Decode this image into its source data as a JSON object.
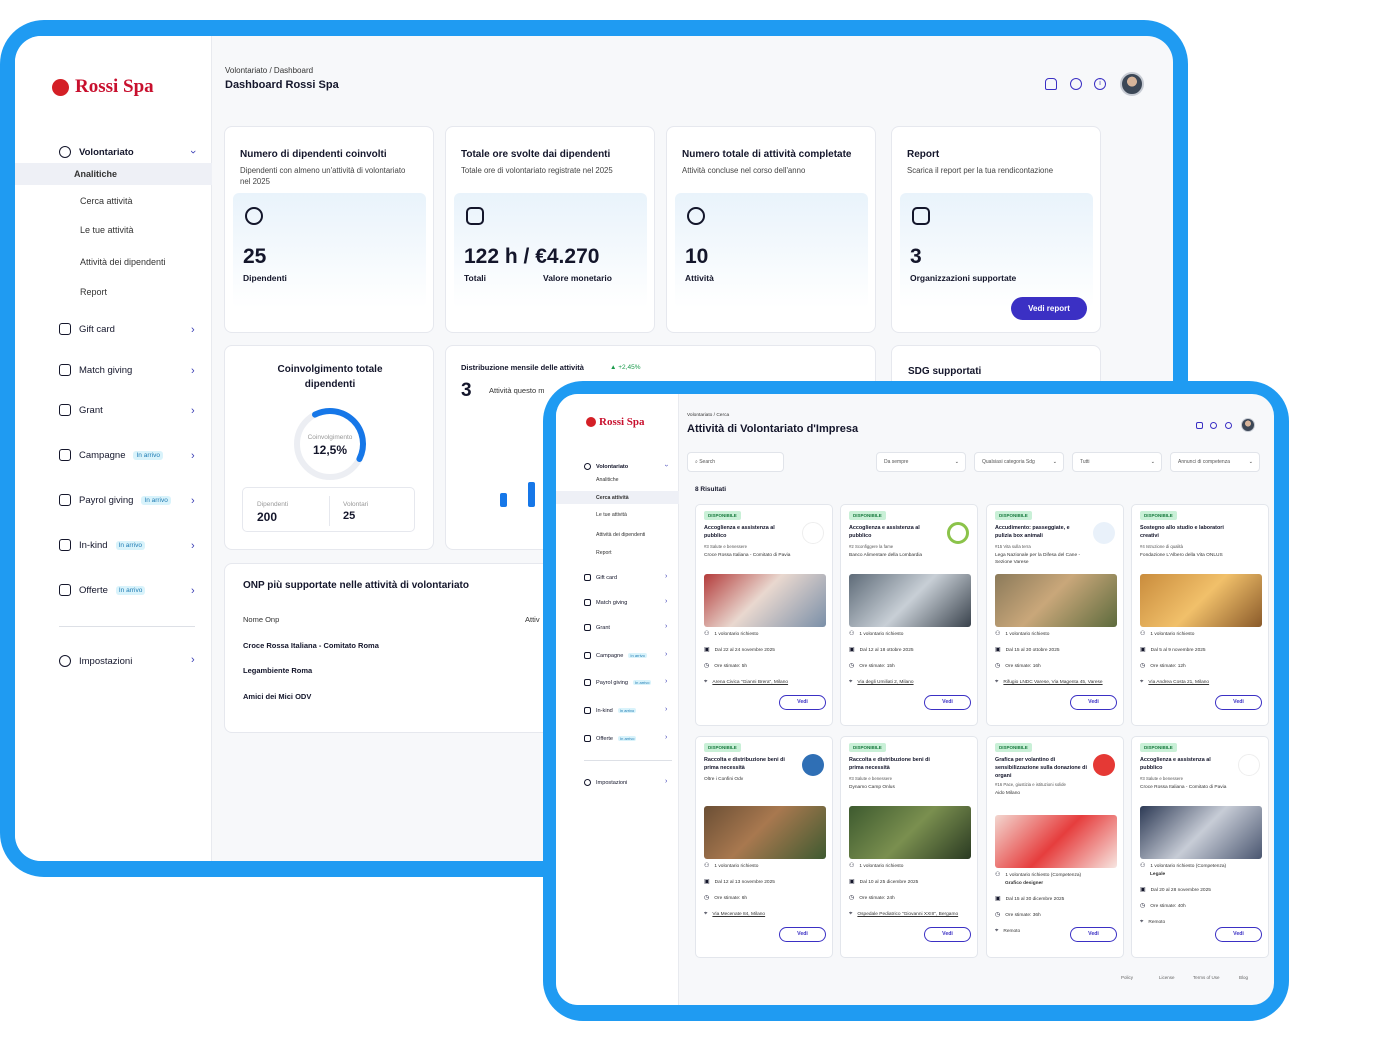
{
  "dashboard": {
    "brand": "Rossi Spa",
    "breadcrumb": "Volontariato / Dashboard",
    "title": "Dashboard Rossi Spa",
    "sidebar": {
      "volontariato": "Volontariato",
      "sub": [
        "Analitiche",
        "Cerca attività",
        "Le tue attività",
        "Attività dei dipendenti",
        "Report"
      ],
      "items": [
        {
          "label": "Gift card",
          "badge": ""
        },
        {
          "label": "Match giving",
          "badge": ""
        },
        {
          "label": "Grant",
          "badge": ""
        },
        {
          "label": "Campagne",
          "badge": "In arrivo"
        },
        {
          "label": "Payrol giving",
          "badge": "In arrivo"
        },
        {
          "label": "In-kind",
          "badge": "In arrivo"
        },
        {
          "label": "Offerte",
          "badge": "In arrivo"
        }
      ],
      "settings": "Impostazioni"
    },
    "cards": [
      {
        "title": "Numero di dipendenti coinvolti",
        "subtitle": "Dipendenti con almeno un'attività di volontariato nel 2025",
        "value": "25",
        "label": "Dipendenti"
      },
      {
        "title": "Totale ore svolte dai dipendenti",
        "subtitle": "Totale ore di volontariato registrate nel 2025",
        "value": "122 h / €4.270",
        "label": "Totali",
        "label2": "Valore monetario"
      },
      {
        "title": "Numero totale di attività completate",
        "subtitle": "Attività concluse nel corso dell'anno",
        "value": "10",
        "label": "Attività"
      },
      {
        "title": "Report",
        "subtitle": "Scarica il report per la tua rendicontazione",
        "value": "3",
        "label": "Organizzazioni supportate",
        "button": "Vedi report"
      }
    ],
    "engagement": {
      "title": "Coinvolgimento totale dipendenti",
      "gauge_label": "Coinvolgimento",
      "gauge_value": "12,5%",
      "gauge_fraction": 0.125,
      "dip_label": "Dipendenti",
      "dip_value": "200",
      "vol_label": "Volontari",
      "vol_value": "25"
    },
    "distribution": {
      "title": "Distribuzione mensile delle attività",
      "trend": "+2,45%",
      "value": "3",
      "caption": "Attività questo m"
    },
    "sdg": {
      "title": "SDG supportati"
    },
    "onp": {
      "title": "ONP più supportate nelle attività di volontariato",
      "col1": "Nome Onp",
      "col2": "Attiv",
      "rows": [
        "Croce Rossa Italiana - Comitato Roma",
        "Legambiente Roma",
        "Amici dei Mici ODV"
      ]
    }
  },
  "search_page": {
    "brand": "Rossi Spa",
    "breadcrumb": "Volontariato / Cerca",
    "title": "Attività di Volontariato d'Impresa",
    "sidebar": {
      "volontariato": "Volontariato",
      "sub": [
        "Analitiche",
        "Cerca attività",
        "Le tue attività",
        "Attività dei dipendenti",
        "Report"
      ],
      "items": [
        {
          "label": "Gift card",
          "badge": ""
        },
        {
          "label": "Match giving",
          "badge": ""
        },
        {
          "label": "Grant",
          "badge": ""
        },
        {
          "label": "Campagne",
          "badge": "In arrivo"
        },
        {
          "label": "Payrol giving",
          "badge": "In arrivo"
        },
        {
          "label": "In-kind",
          "badge": "In arrivo"
        },
        {
          "label": "Offerte",
          "badge": "In arrivo"
        }
      ],
      "settings": "Impostazioni"
    },
    "search_placeholder": "Search",
    "filters": [
      "Da sempre",
      "Qualsiasi categoria Sdg",
      "Tutti",
      "Annunci di competenza"
    ],
    "results": "8 Risultati",
    "status_label": "DISPONIBILE",
    "button": "Vedi",
    "activities": [
      {
        "title": "Accoglienza e assistenza al pubblico",
        "cat": "#3 Salute e benessere",
        "org": "Croce Rossa Italiana - Comitato di Pavia",
        "vol": "1 volontario richiesto",
        "date": "Dal 22 al 24 novembre 2025",
        "hours": "Ore stimate: 5h",
        "place": "Arena Civica \"Gianni Brera\", Milano",
        "extra": ""
      },
      {
        "title": "Accoglienza e assistenza al pubblico",
        "cat": "#2 Sconfiggere la fame",
        "org": "Banco Alimentare della Lombardia",
        "vol": "1 volontario richiesto",
        "date": "Dal 12 al 18 ottobre 2025",
        "hours": "Ore stimate: 15h",
        "place": "Via degli Umiliati 2, Milano",
        "extra": ""
      },
      {
        "title": "Accudimento: passeggiate, e pulizia box animali",
        "cat": "#15 Vita sulla terra",
        "org": "Lega Nazionale per la Difesa del Cane - Sezione Varese",
        "vol": "1 volontario richiesto",
        "date": "Dal 15 al 30 ottobre 2025",
        "hours": "Ore stimate: 16h",
        "place": "Rifugio LNDC Varese, Via Magenta 45, Varese",
        "extra": ""
      },
      {
        "title": "Sostegno allo studio e laboratori creativi",
        "cat": "#4 Istruzione di qualità",
        "org": "Fondazione L'Albero della Vita ONLUS",
        "vol": "1 volontario richiesto",
        "date": "Dal 5 al 9 novembre 2025",
        "hours": "Ore stimate: 12h",
        "place": "Via Andrea Costa 21, Milano",
        "extra": ""
      },
      {
        "title": "Raccolta e distribuzione beni di prima necessità",
        "cat": "",
        "org": "Oltre i Confini Odv",
        "vol": "1 volontario richiesto",
        "date": "Dal 12 al 13 novembre 2025",
        "hours": "Ore stimate: 6h",
        "place": "Via Mecenate 84, Milano",
        "extra": ""
      },
      {
        "title": "Raccolta e distribuzione beni di prima necessità",
        "cat": "#3 Salute e benessere",
        "org": "Dynamo Camp Onlus",
        "vol": "1 volontario richiesto",
        "date": "Dal 10 al 25 dicembre 2025",
        "hours": "Ore stimate: 24h",
        "place": "Ospedale Pediatrico \"Giovanni XXIII\", Bergamo",
        "extra": ""
      },
      {
        "title": "Grafica per volantino di sensibilizzazione sulla donazione di organi",
        "cat": "#16 Pace, giustizia e istituzioni solide",
        "org": "Aido Milano",
        "vol": "1 volontario richiesto (Competenza)",
        "date": "Dal 15 al 30 dicembre 2025",
        "hours": "Ore stimate: 36h",
        "place": "Remoto",
        "extra": "Grafico designer"
      },
      {
        "title": "Accoglienza e assistenza al pubblico",
        "cat": "#3 Salute e benessere",
        "org": "Croce Rossa Italiana - Comitato di Pavia",
        "vol": "1 volontario richiesto (Competenza)",
        "date": "Dal 20 al 28 novembre 2025",
        "hours": "Ore stimate: 40h",
        "place": "Remoto",
        "extra": "Legale"
      }
    ],
    "footer": [
      "Policy",
      "License",
      "Terms of Use",
      "Blog"
    ]
  }
}
